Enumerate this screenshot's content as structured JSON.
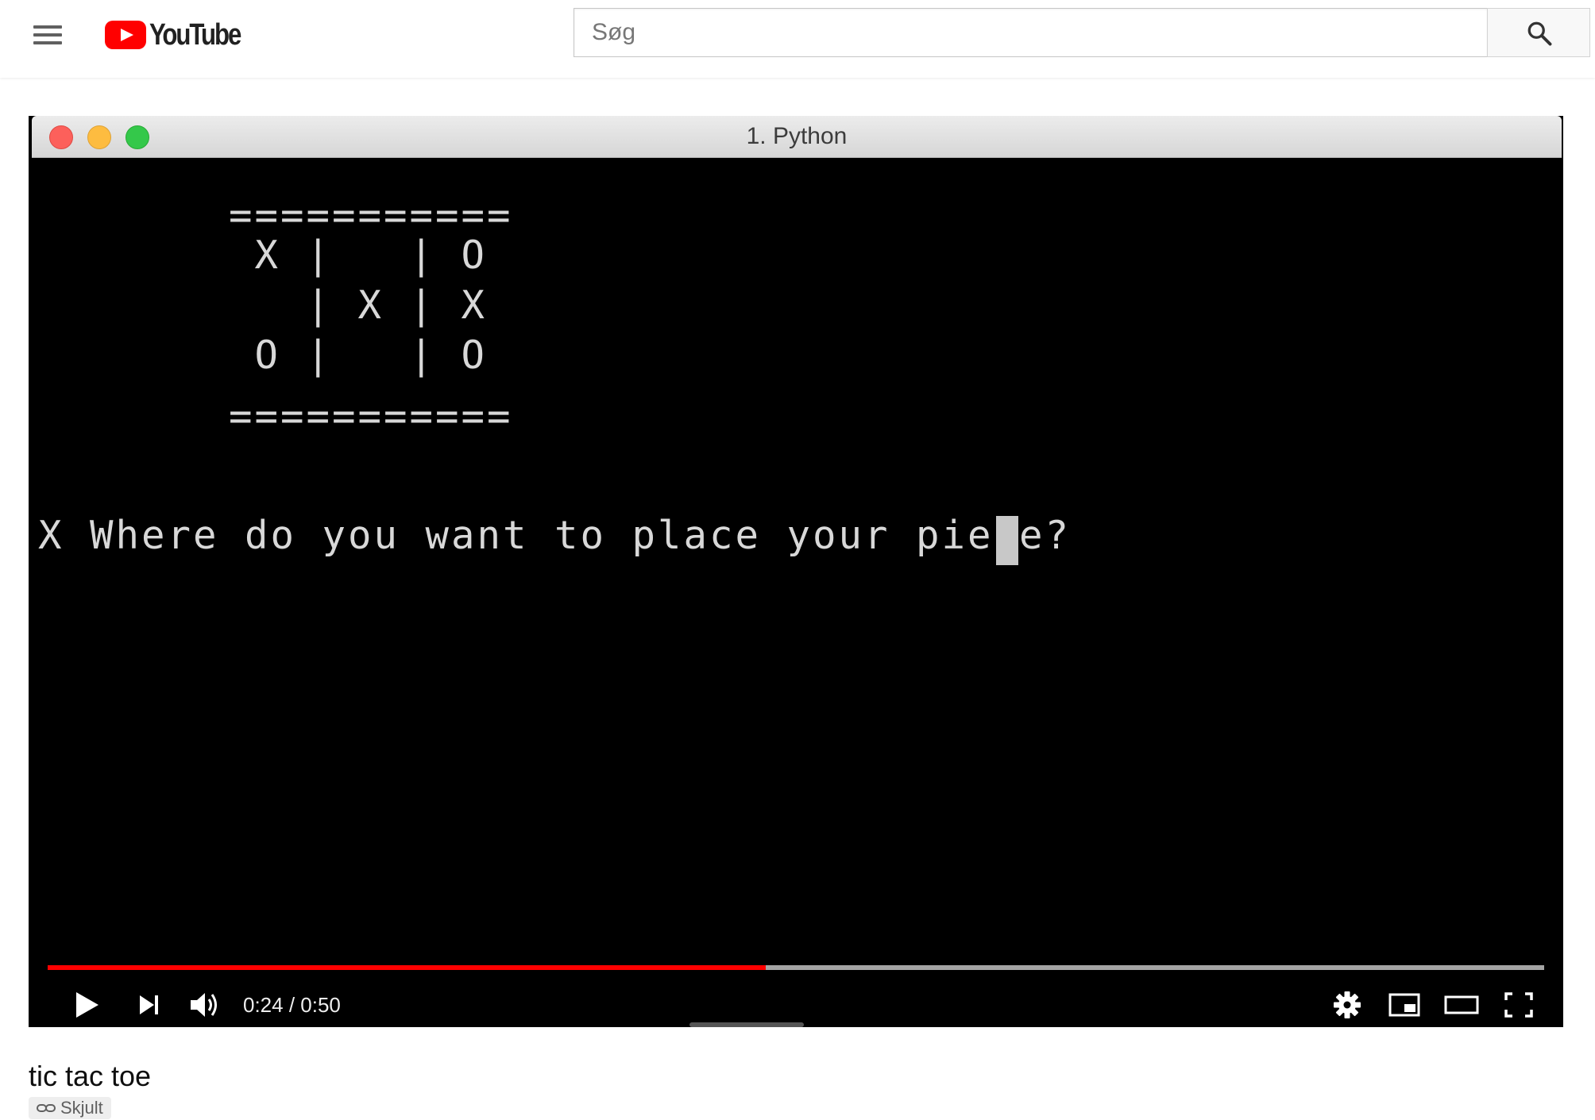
{
  "masthead": {
    "logo_text": "YouTube",
    "search_placeholder": "Søg"
  },
  "terminal": {
    "title": "1. Python",
    "board": {
      "border": "===========",
      "rows": [
        " X |   | O",
        "   | X | X",
        " O |   | O"
      ]
    },
    "prompt": "X Where do you want to place your piece?"
  },
  "player": {
    "current_time": "0:24",
    "duration": "0:50",
    "time_text": "0:24 / 0:50",
    "progress_fraction": 0.48
  },
  "video": {
    "title": "tic tac toe",
    "privacy": "Skjult"
  },
  "colors": {
    "accent": "#ff0000",
    "terminal_bg": "#000000",
    "terminal_text": "#d8d8d8"
  },
  "icons": {
    "menu": "hamburger-menu-icon",
    "search": "search-icon",
    "play": "play-icon",
    "next": "next-track-icon",
    "volume": "volume-icon",
    "settings": "gear-icon",
    "miniplayer": "miniplayer-icon",
    "theater": "theater-mode-icon",
    "fullscreen": "fullscreen-icon",
    "privacy": "link-icon"
  }
}
